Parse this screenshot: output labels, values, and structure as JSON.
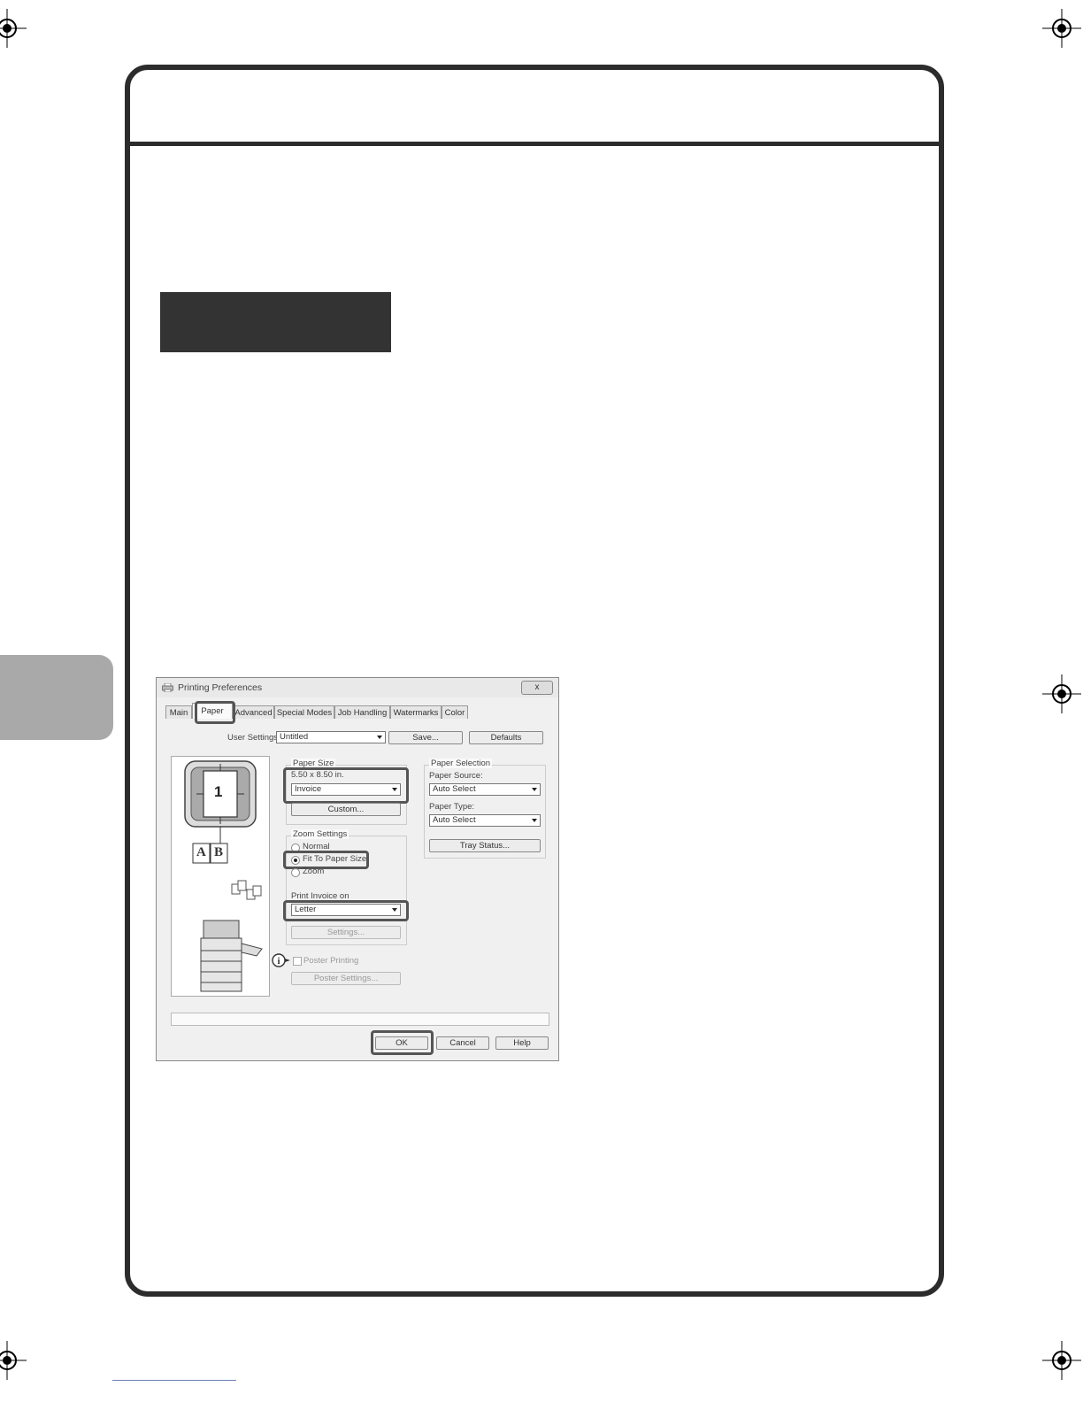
{
  "dialog": {
    "title": "Printing Preferences",
    "close_label": "x",
    "tabs": [
      {
        "label": "Main"
      },
      {
        "label": "Paper"
      },
      {
        "label": "Advanced"
      },
      {
        "label": "Special Modes"
      },
      {
        "label": "Job Handling"
      },
      {
        "label": "Watermarks"
      },
      {
        "label": "Color"
      }
    ],
    "selected_tab": "Paper",
    "user_settings_label": "User Settings",
    "user_settings_value": "Untitled",
    "save_label": "Save...",
    "defaults_label": "Defaults",
    "paper_size": {
      "group_label": "Paper Size",
      "size_text": "5.50 x 8.50 in.",
      "value": "Invoice",
      "custom_label": "Custom..."
    },
    "zoom": {
      "group_label": "Zoom Settings",
      "options": [
        "Normal",
        "Fit To Paper Size",
        "Zoom"
      ],
      "selected": "Fit To Paper Size",
      "print_on_label": "Print Invoice on",
      "print_on_value": "Letter",
      "settings_label": "Settings..."
    },
    "poster": {
      "checkbox_label": "Poster Printing",
      "settings_label": "Poster Settings..."
    },
    "paper_selection": {
      "group_label": "Paper Selection",
      "source_label": "Paper Source:",
      "source_value": "Auto Select",
      "type_label": "Paper Type:",
      "type_value": "Auto Select",
      "tray_status_label": "Tray Status..."
    },
    "preview": {
      "page_number": "1",
      "ab_left": "A",
      "ab_right": "B"
    },
    "footer": {
      "ok_label": "OK",
      "cancel_label": "Cancel",
      "help_label": "Help"
    }
  },
  "colors": {
    "frame": "#2c2c2c",
    "side_tab": "#a9a9a9",
    "highlight": "#555555",
    "underline": "#6a7fb8"
  }
}
